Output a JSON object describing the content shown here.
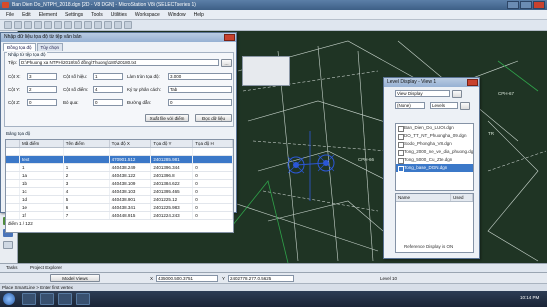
{
  "window": {
    "title": "Ban Dien Do_NTPH_2018.dgn [2D - V8 DGN] - MicroStation V8i (SELECTseries 1)"
  },
  "menu": [
    "File",
    "Edit",
    "Element",
    "Settings",
    "Tools",
    "Utilities",
    "Workspace",
    "Window",
    "Help"
  ],
  "left_panel": {
    "label": "Tools"
  },
  "dialog": {
    "title": "Nhập dữ liệu tọa độ từ tệp văn bản",
    "tabs": [
      "Đồng tọa độ",
      "Tùy chọn"
    ],
    "file_group_title": "Nhập từ tệp tọa độ",
    "file_label": "Tệp:",
    "file_path": "D:\\Phuong xa NTPH\\2018\\Số đồng\\Thuong\\180\\20180.txt",
    "rows": [
      {
        "label": "Cột X:",
        "value": "3",
        "label2": "Cột số hiệu:",
        "value2": "1",
        "label3": "Làm tròn tọa độ:",
        "value3": "3.000"
      },
      {
        "label": "Cột Y:",
        "value": "2",
        "label2": "Cột số điểm:",
        "value2": "4",
        "label3": "Ký tự phân cách:",
        "value3": "Tab"
      },
      {
        "label": "Cột Z:",
        "value": "0",
        "label2": "Bỏ qua:",
        "value2": "0",
        "label3": "Đường dẫn:",
        "value3": "0"
      }
    ],
    "buttons": {
      "preview": "Xuất file với điểm",
      "read": "Đọc dữ liệu"
    },
    "table_group_title": "Bảng tọa độ",
    "table_headers": [
      "Mã điểm",
      "Tên điểm",
      "Tọa độ X",
      "Tọa độ Y",
      "Tọa độ H"
    ],
    "table_rows": [
      [
        "",
        "",
        "",
        "",
        ""
      ],
      [
        "text",
        "",
        "470901.512",
        "2401285.981",
        ""
      ],
      [
        "1",
        "1",
        "440438.249",
        "2401396.344",
        "0"
      ],
      [
        "1a",
        "2",
        "440438.122",
        "2401396.8",
        "0"
      ],
      [
        "1b",
        "3",
        "440438.109",
        "2401384.622",
        "0"
      ],
      [
        "1c",
        "4",
        "440438.103",
        "2401395.465",
        "0"
      ],
      [
        "1d",
        "5",
        "440438.901",
        "2401225.12",
        "0"
      ],
      [
        "1e",
        "6",
        "440438.341",
        "2401225.983",
        "0"
      ],
      [
        "1f",
        "7",
        "440448.915",
        "2401224.243",
        "0"
      ]
    ],
    "footer": "điểm 1 / 122"
  },
  "level_display": {
    "title": "Level Display - View 1",
    "dropdown1": "View Display",
    "dropdown2": "(None)",
    "dropdown3": "Levels",
    "levels": [
      "Ban_Dien_Do_LUOI.dgn",
      "DO_TT_NT_Phuongha_09.dgn",
      "Sodo_Phongha_V8.dgn",
      "Tong_2000_ne_ve_dia_phuong.dgn",
      "Tong_5000_Cu_Zte.dgn",
      "Tong_base_DGN.dgn"
    ],
    "selected_index": 5,
    "column_header_name": "Name",
    "column_header_used": "Used",
    "footer": "Reference Display is ON"
  },
  "map_labels": {
    "cph67": "CPH-67",
    "cph66": "CPH-66",
    "tr": "TR"
  },
  "status": {
    "tabs": [
      "Tasks",
      "Project Explorer"
    ],
    "prompt": "Place SmartLine > Enter first vertex",
    "view": "Model Views",
    "x_coord": "435000.500.3751",
    "y_coord": "2402778.277.0.5625",
    "level": "Level 10",
    "clock": "10:14 PM"
  },
  "colors": {
    "accent": "#3b78c8",
    "map_bg": "#1f3424",
    "map_line": "#c8d4cc",
    "map_green": "#2fa34a"
  }
}
